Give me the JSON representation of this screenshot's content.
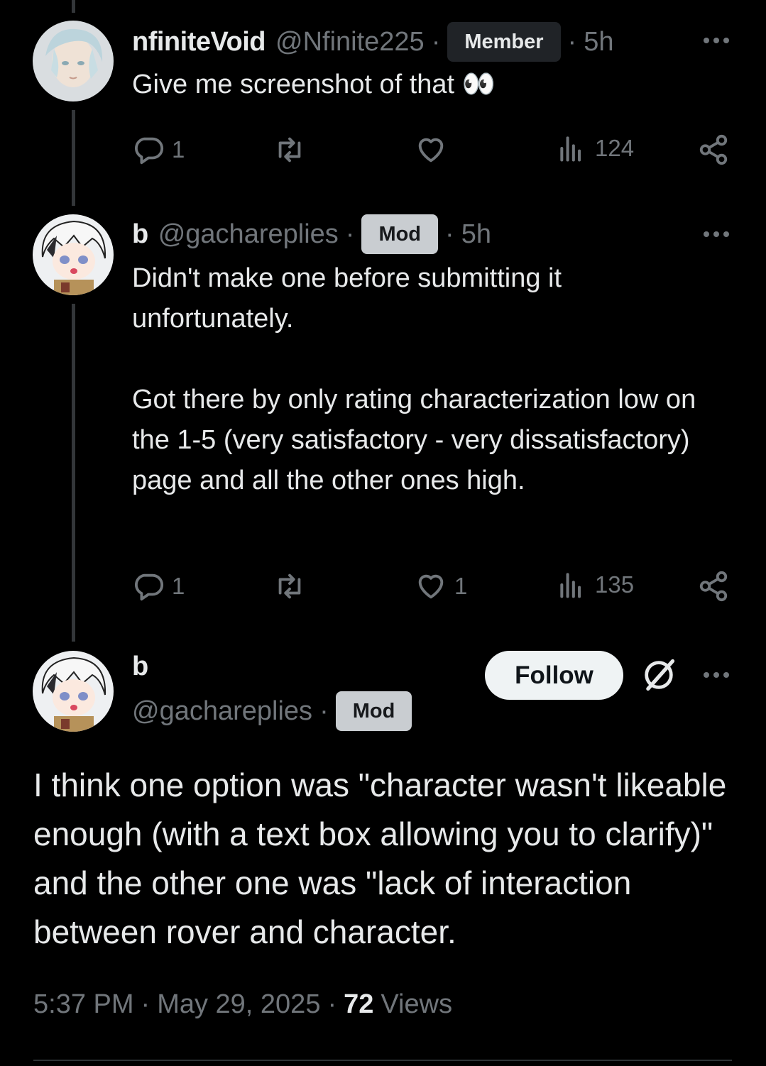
{
  "replies": [
    {
      "name": "nfiniteVoid",
      "handle": "@Nfinite225",
      "badge": "Member",
      "time": "5h",
      "text": "Give me screenshot of that 👀",
      "reply_count": "1",
      "repost_count": "",
      "like_count": "",
      "view_count": "124"
    },
    {
      "name": "b",
      "handle": "@gachareplies",
      "badge": "Mod",
      "time": "5h",
      "text_p1": "Didn't make one before submitting it unfortunately.",
      "text_p2": "Got there by only rating characterization low on the 1-5 (very satisfactory - very dissatisfactory) page and all the other ones high.",
      "reply_count": "1",
      "repost_count": "",
      "like_count": "1",
      "view_count": "135"
    }
  ],
  "main": {
    "name": "b",
    "handle": "@gachareplies",
    "badge": "Mod",
    "follow_label": "Follow",
    "text": "I think one option was \"character wasn't likeable enough (with a text box allowing you to clarify)\" and the other one was \"lack of interaction between rover and character.",
    "time": "5:37 PM",
    "date": "May 29, 2025",
    "views_count": "72",
    "views_label": "Views"
  },
  "separator": "·",
  "colors": {
    "background": "#000000",
    "text": "#e7e9ea",
    "muted": "#71767b",
    "mod_badge": "#c9cdd1",
    "member_badge": "#202327"
  },
  "icons": [
    "reply-icon",
    "repost-icon",
    "like-icon",
    "views-icon",
    "share-icon",
    "more-icon",
    "grok-icon"
  ]
}
